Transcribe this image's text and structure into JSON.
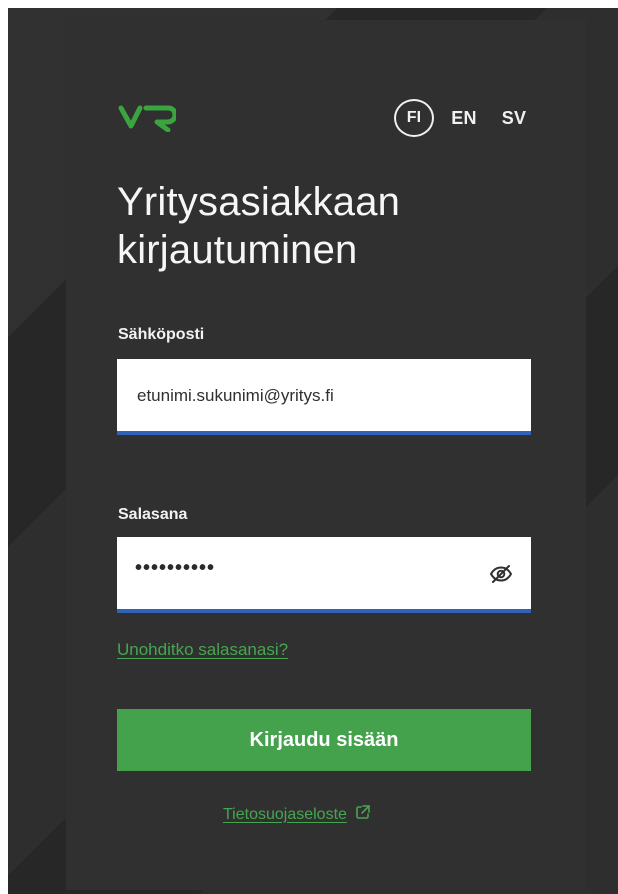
{
  "languages": {
    "fi": "FI",
    "en": "EN",
    "sv": "SV"
  },
  "login": {
    "title_line1": "Yritysasiakkaan",
    "title_line2": "kirjautuminen",
    "email_label": "Sähköposti",
    "email_value": "etunimi.sukunimi@yritys.fi",
    "password_label": "Salasana",
    "password_value": "••••••••••",
    "forgot_password": "Unohditko salasanasi?",
    "submit": "Kirjaudu sisään",
    "privacy_link": "Tietosuojaseloste"
  },
  "icons": {
    "logo": "vr-logo",
    "password_visibility": "eye-slash-icon",
    "external_link": "external-link-icon"
  },
  "colors": {
    "background": "#2a2a2a",
    "card": "#303030",
    "accent": "#45a24c",
    "field_border": "#2f63b8",
    "text": "#f6f6f6"
  }
}
